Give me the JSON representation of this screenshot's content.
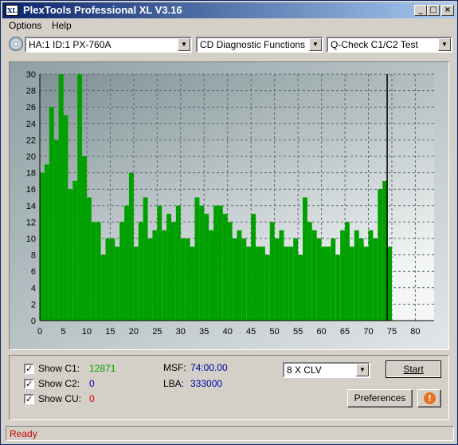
{
  "window": {
    "title": "PlexTools Professional XL V3.16",
    "icon_text": "XL"
  },
  "title_buttons": {
    "minimize": "_",
    "maximize": "□",
    "close": "×"
  },
  "menu": {
    "items": [
      "Options",
      "Help"
    ]
  },
  "toolbar": {
    "drive": "HA:1 ID:1  PX-760A",
    "function": "CD Diagnostic Functions",
    "test": "Q-Check C1/C2 Test"
  },
  "chart_data": {
    "type": "bar",
    "xlim": [
      0,
      84
    ],
    "ylim": [
      0,
      30
    ],
    "x_ticks": [
      0,
      5,
      10,
      15,
      20,
      25,
      30,
      35,
      40,
      45,
      50,
      55,
      60,
      65,
      70,
      75,
      80
    ],
    "y_ticks": [
      0,
      2,
      4,
      6,
      8,
      10,
      12,
      14,
      16,
      18,
      20,
      22,
      24,
      26,
      28,
      30
    ],
    "end_marker_x": 74,
    "series": [
      {
        "name": "C1",
        "color": "#00a000",
        "x": [
          0,
          1,
          2,
          3,
          4,
          5,
          6,
          7,
          8,
          9,
          10,
          11,
          12,
          13,
          14,
          15,
          16,
          17,
          18,
          19,
          20,
          21,
          22,
          23,
          24,
          25,
          26,
          27,
          28,
          29,
          30,
          31,
          32,
          33,
          34,
          35,
          36,
          37,
          38,
          39,
          40,
          41,
          42,
          43,
          44,
          45,
          46,
          47,
          48,
          49,
          50,
          51,
          52,
          53,
          54,
          55,
          56,
          57,
          58,
          59,
          60,
          61,
          62,
          63,
          64,
          65,
          66,
          67,
          68,
          69,
          70,
          71,
          72,
          73,
          74
        ],
        "values": [
          18,
          19,
          26,
          22,
          30,
          25,
          16,
          17,
          30,
          20,
          15,
          12,
          12,
          8,
          10,
          10,
          9,
          12,
          14,
          18,
          9,
          12,
          15,
          10,
          11,
          14,
          11,
          13,
          12,
          14,
          10,
          10,
          9,
          15,
          14,
          13,
          11,
          14,
          14,
          13,
          12,
          10,
          11,
          10,
          9,
          13,
          9,
          9,
          8,
          12,
          10,
          11,
          9,
          9,
          10,
          8,
          15,
          12,
          11,
          10,
          9,
          9,
          10,
          8,
          11,
          12,
          9,
          11,
          10,
          9,
          11,
          10,
          16,
          17,
          9
        ]
      }
    ]
  },
  "stats": {
    "show_c1_label": "Show C1:",
    "c1_value": "12871",
    "show_c2_label": "Show C2:",
    "c2_value": "0",
    "show_cu_label": "Show CU:",
    "cu_value": "0",
    "check_mark": "✓",
    "msf_label": "MSF:",
    "msf_value": "74:00.00",
    "lba_label": "LBA:",
    "lba_value": "333000"
  },
  "speed": {
    "selected": "8 X CLV"
  },
  "buttons": {
    "start": "Start",
    "preferences": "Preferences",
    "info_icon": "!"
  },
  "status": {
    "text": "Ready"
  },
  "colors": {
    "c1_value": "#00a000",
    "c2_value": "#0000c0",
    "cu_value": "#e00000",
    "status_text": "#c00000",
    "info_button": "#e87020"
  }
}
